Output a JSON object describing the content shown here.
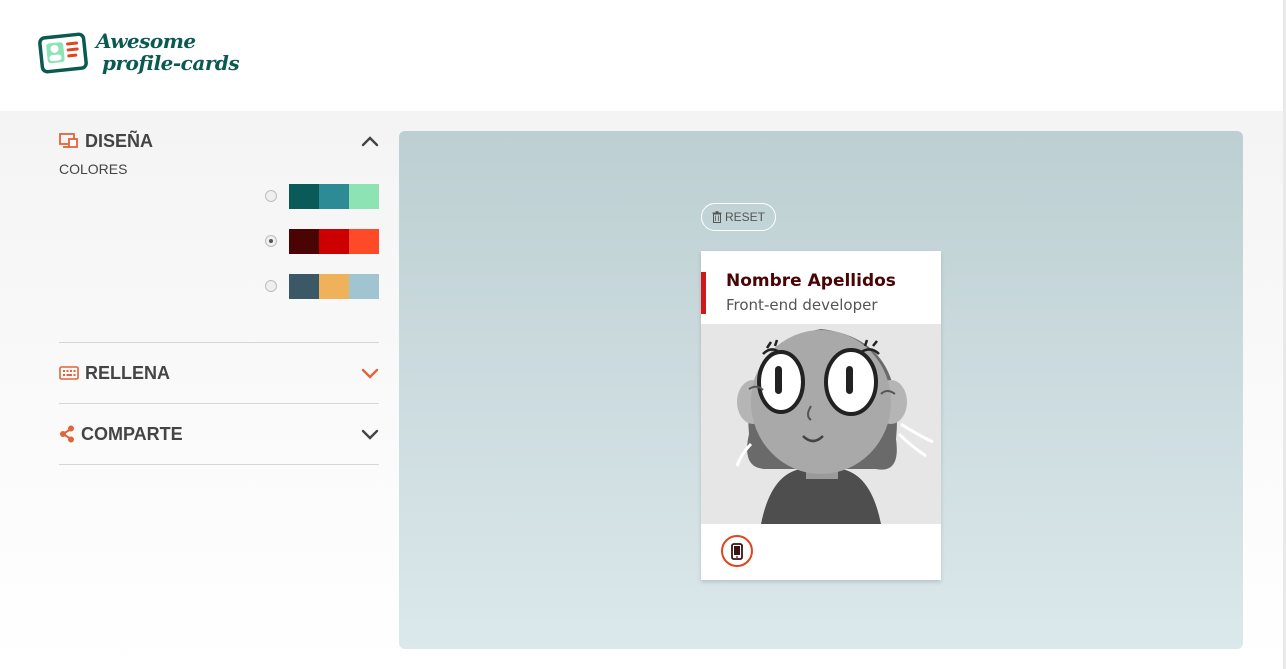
{
  "header": {
    "logo_line1": "Awesome",
    "logo_line2": "profile-cards"
  },
  "sidebar": {
    "design": {
      "title": "DISEÑA",
      "icon": "design-icon",
      "expanded": true
    },
    "colors_label": "COLORES",
    "palettes": [
      {
        "selected": false,
        "colors": [
          "#0b5a5a",
          "#2d8b96",
          "#8ee3b5"
        ]
      },
      {
        "selected": true,
        "colors": [
          "#4a0404",
          "#cc0000",
          "#ff4a27"
        ]
      },
      {
        "selected": false,
        "colors": [
          "#3a5866",
          "#efb25a",
          "#a0c4d0"
        ]
      }
    ],
    "fill": {
      "title": "RELLENA",
      "icon": "keyboard-icon",
      "expanded": false
    },
    "share": {
      "title": "COMPARTE",
      "icon": "share-icon",
      "expanded": false
    }
  },
  "preview": {
    "reset_label": "RESET",
    "card": {
      "name": "Nombre Apellidos",
      "job": "Front-end developer",
      "contact_icon": "mobile-phone-icon"
    }
  },
  "colors": {
    "accent": "#e0451f",
    "icon_orange": "#e0653a",
    "brand_green": "#0b5a52"
  }
}
